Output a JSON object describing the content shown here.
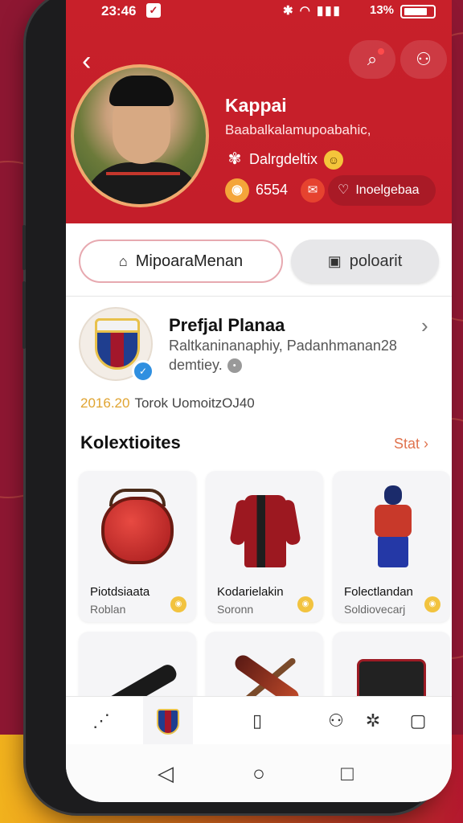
{
  "status_bar": {
    "time": "23:46",
    "battery_pct": "13%"
  },
  "header": {
    "back_label": "‹"
  },
  "profile": {
    "name": "Kappai",
    "subtitle": "Baabalkalamupoabahic,",
    "club": "Dalrgdeltix",
    "coin_count": "6554",
    "like_label": "Inoelgebaa"
  },
  "actions": {
    "primary_label": "MipoaraMenan",
    "secondary_label": "poloarit"
  },
  "club_card": {
    "title": "Prefjal Planaa",
    "desc_line1": "Raltkaninanaphiy, Padanhmanan28",
    "desc_line2": "demtiey.",
    "year": "2016.20",
    "meta": "Torok UomoitzOJ40"
  },
  "collections": {
    "title": "Kolextioites",
    "link": "Stat",
    "items": [
      {
        "title": "Piotdsiaata",
        "sub": "Roblan",
        "icon": "bag-icon"
      },
      {
        "title": "Kodarielakin",
        "sub": "Soronn",
        "icon": "jersey-icon"
      },
      {
        "title": "Folectlandan",
        "sub": "Soldiovecarj",
        "icon": "player-figure-icon"
      },
      {
        "icon": "stick-icon"
      },
      {
        "icon": "bat-icon"
      },
      {
        "icon": "device-icon"
      }
    ]
  },
  "bottom_nav": {
    "items": [
      "share-icon",
      "club-crest-icon",
      "trash-icon",
      "profile-icon",
      "settings-icon",
      "square-icon"
    ]
  },
  "colors": {
    "brand": "#c41e2a",
    "accent": "#e0734e",
    "coin": "#f4a53a"
  }
}
